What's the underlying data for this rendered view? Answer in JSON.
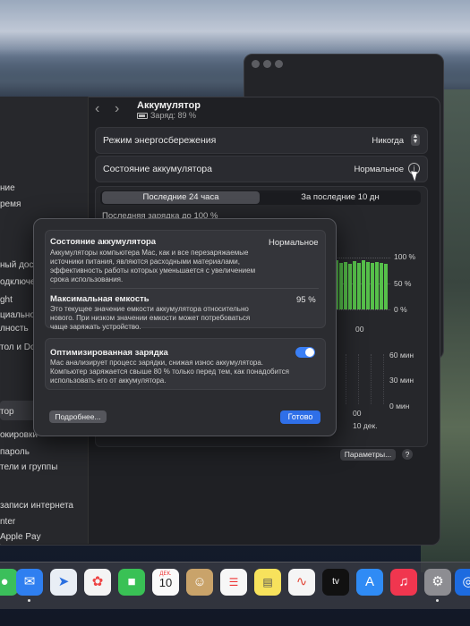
{
  "window": {
    "title": "Аккумулятор",
    "subtitle": "Заряд: 89 %"
  },
  "sidebar": {
    "items": [
      "",
      "ние",
      "ремя",
      "",
      "ный дост",
      "одключен",
      "ght",
      "циальност",
      "лность",
      "тол и Doc",
      "",
      "тор",
      "окировки",
      "пароль",
      "тели и группы",
      "",
      "записи интернета",
      "nter",
      "Apple Pay"
    ]
  },
  "rows": {
    "energy_saver": {
      "label": "Режим энергосбережения",
      "value": "Никогда"
    },
    "battery_health": {
      "label": "Состояние аккумулятора",
      "value": "Нормальное"
    }
  },
  "segment": {
    "tab1": "Последние 24 часа",
    "tab2": "За последние 10 дн"
  },
  "history": {
    "last_charge": "Последняя зарядка до 100 %",
    "level_labels": [
      "100 %",
      "50 %",
      "0 %"
    ],
    "time_label": "00",
    "usage_labels": [
      "60 мин",
      "30 мин",
      "0 мин"
    ],
    "usage_time": "00",
    "usage_date": "10 дек.",
    "params_button": "Параметры...",
    "help": "?"
  },
  "chart_data": {
    "type": "bar",
    "title": "",
    "values": [
      95,
      90,
      92,
      88,
      93,
      90,
      94,
      91,
      89,
      92,
      90,
      88
    ],
    "ylim": [
      0,
      100
    ],
    "yticks": [
      "0 %",
      "50 %",
      "100 %"
    ]
  },
  "modal": {
    "health_title": "Состояние аккумулятора",
    "health_value": "Нормальное",
    "health_desc": "Аккумуляторы компьютера Mac, как и все перезаряжаемые источники питания, являются расходными материалами, эффективность работы которых уменьшается с увеличением срока использования.",
    "capacity_title": "Максимальная емкость",
    "capacity_value": "95 %",
    "capacity_desc": "Это текущее значение емкости аккумулятора относительно нового. При низком значении емкости может потребоваться чаще заряжать устройство.",
    "optimized_title": "Оптимизированная зарядка",
    "optimized_desc": "Mac анализирует процесс зарядки, снижая износ аккумулятора. Компьютер заряжается свыше 80 % только перед тем, как понадобится использовать его от аккумулятора.",
    "optimized_on": true,
    "more_button": "Подробнее...",
    "done_button": "Готово"
  },
  "dock": {
    "calendar_month": "ДЕК.",
    "calendar_day": "10",
    "tv_label": "tv"
  },
  "colors": {
    "accent": "#2f6fe8",
    "battery_bar": "#56c04a"
  }
}
